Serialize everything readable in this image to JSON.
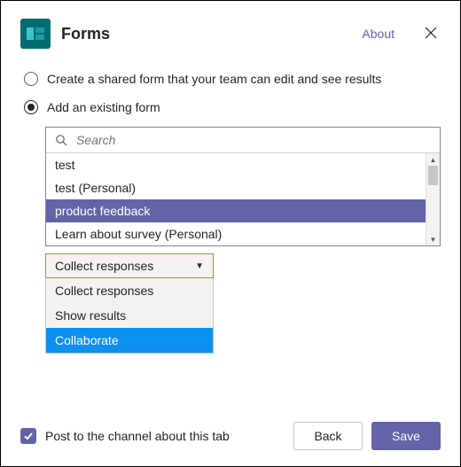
{
  "header": {
    "title": "Forms",
    "about_label": "About"
  },
  "options": {
    "create_label": "Create a shared form that your team can edit and see results",
    "add_label": "Add an existing form",
    "selected": "add"
  },
  "search": {
    "placeholder": "Search",
    "items": [
      {
        "label": "test",
        "selected": false
      },
      {
        "label": "test (Personal)",
        "selected": false
      },
      {
        "label": "product feedback",
        "selected": true
      },
      {
        "label": "Learn about survey (Personal)",
        "selected": false
      }
    ]
  },
  "action_select": {
    "selected_label": "Collect responses",
    "options": [
      {
        "label": "Collect responses",
        "highlight": false
      },
      {
        "label": "Show results",
        "highlight": false
      },
      {
        "label": "Collaborate",
        "highlight": true
      }
    ]
  },
  "footer": {
    "post_label": "Post to the channel about this tab",
    "post_checked": true,
    "back_label": "Back",
    "save_label": "Save"
  },
  "colors": {
    "brand": "#6264a7",
    "select_border": "#bb8d0a",
    "highlight": "#0b90f0",
    "app_icon_bg": "#036c70"
  }
}
